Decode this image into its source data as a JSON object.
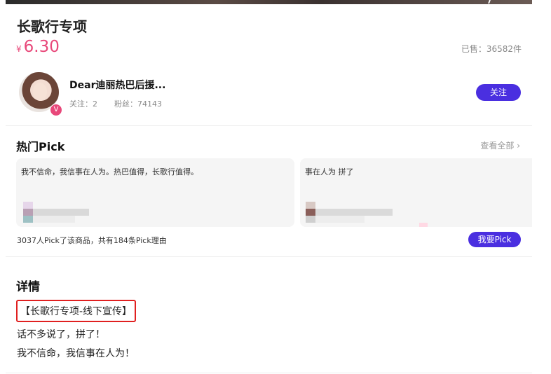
{
  "product": {
    "title": "长歌行专项",
    "currency": "¥",
    "price": "6.30",
    "sold": "已售：36582件"
  },
  "user": {
    "name": "Dear迪丽热巴后援...",
    "badge": "V",
    "follow_count": "关注：2",
    "fans_count": "粉丝：74143",
    "follow_button": "关注"
  },
  "hot_pick": {
    "title": "热门Pick",
    "see_all": "查看全部 ›",
    "cards": [
      {
        "text": "我不信命，我信事在人为。热巴值得，长歌行值得。"
      },
      {
        "text": "事在人为 拼了"
      }
    ],
    "summary": "3037人Pick了该商品，共有184条Pick理由",
    "pick_button": "我要Pick"
  },
  "details": {
    "title": "详情",
    "highlight": "【长歌行专项-线下宣传】",
    "lines": [
      "话不多说了，拼了！",
      "我不信命，我信事在人为！"
    ]
  },
  "colors": {
    "accent": "#4a2fe0",
    "price": "#e8487a",
    "highlight_border": "#e02020"
  }
}
